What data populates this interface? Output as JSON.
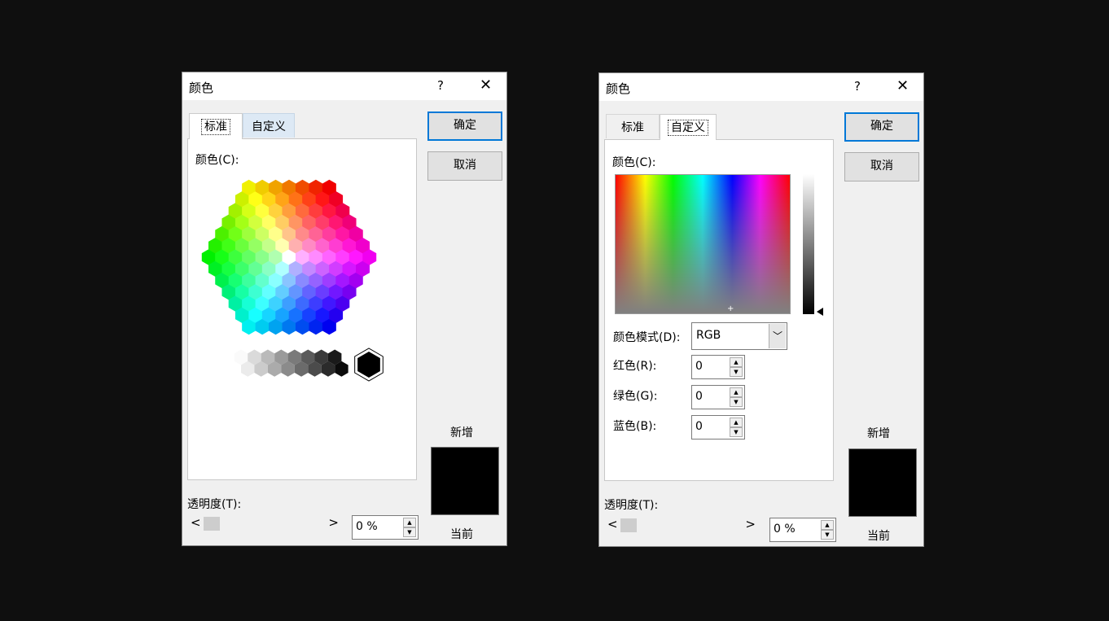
{
  "dialogs": [
    {
      "title": "颜色",
      "help": "?",
      "close": "✕",
      "tabs": [
        {
          "label": "标准"
        },
        {
          "label": "自定义"
        }
      ],
      "active_tab": "标准",
      "colors_label": "颜色(C):",
      "ok_label": "确定",
      "cancel_label": "取消",
      "new_label": "新增",
      "current_label": "当前",
      "transparency_label": "透明度(T):",
      "transparency_value": "0 %",
      "transparency_level": 0,
      "new_color": "#000000",
      "current_color": "#000000",
      "selected_swatch": "#000000"
    },
    {
      "title": "颜色",
      "help": "?",
      "close": "✕",
      "tabs": [
        {
          "label": "标准"
        },
        {
          "label": "自定义"
        }
      ],
      "active_tab": "自定义",
      "colors_label": "颜色(C):",
      "color_model_label": "颜色模式(D):",
      "color_model_value": "RGB",
      "red_label": "红色(R):",
      "red_value": "0",
      "green_label": "绿色(G):",
      "green_value": "0",
      "blue_label": "蓝色(B):",
      "blue_value": "0",
      "ok_label": "确定",
      "cancel_label": "取消",
      "new_label": "新增",
      "current_label": "当前",
      "transparency_label": "透明度(T):",
      "transparency_value": "0 %",
      "transparency_level": 0,
      "new_color": "#000000",
      "current_color": "#000000"
    }
  ],
  "icons": {
    "help": "question-icon",
    "close": "close-icon",
    "scroll_left": "arrow-left-icon",
    "scroll_right": "arrow-right-icon",
    "spin_up": "spin-up-icon",
    "spin_down": "spin-down-icon",
    "dropdown": "chevron-down-icon"
  }
}
